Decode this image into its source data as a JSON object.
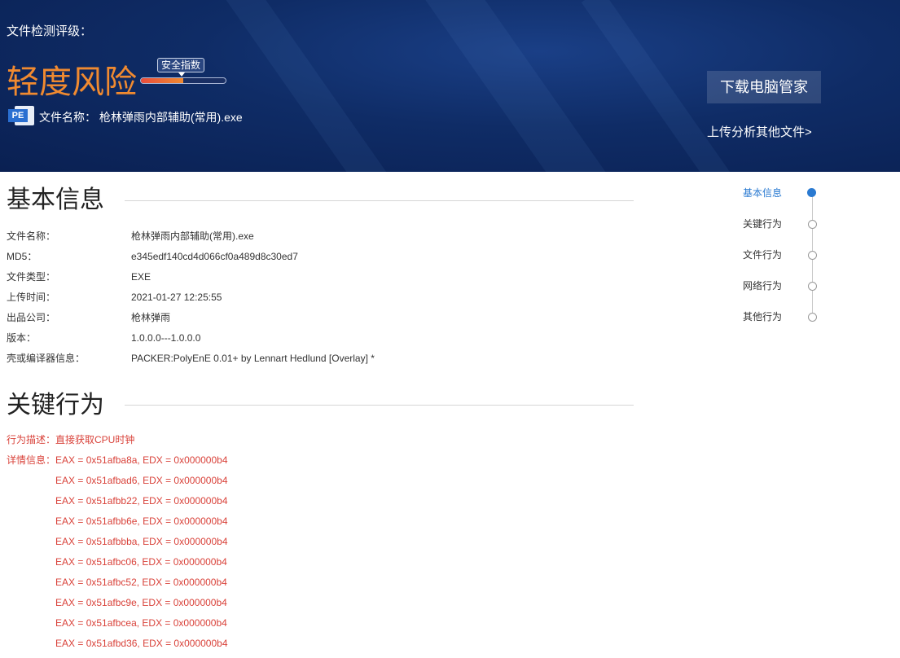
{
  "banner": {
    "rating_label": "文件检测评级：",
    "risk_level": "轻度风险",
    "safety_tag": "安全指数",
    "safety_index_fraction": 0.5,
    "pe_badge": "PE",
    "file_name_label": "文件名称：",
    "file_name": "枪林弹雨内部辅助(常用).exe",
    "download_button": "下载电脑管家",
    "upload_link": "上传分析其他文件>"
  },
  "basic_info": {
    "title": "基本信息",
    "rows": [
      {
        "label": "文件名称：",
        "value": "枪林弹雨内部辅助(常用).exe"
      },
      {
        "label": "MD5：",
        "value": "e345edf140cd4d066cf0a489d8c30ed7"
      },
      {
        "label": "文件类型：",
        "value": "EXE"
      },
      {
        "label": "上传时间：",
        "value": "2021-01-27 12:25:55"
      },
      {
        "label": "出品公司：",
        "value": "枪林弹雨"
      },
      {
        "label": "版本：",
        "value": "1.0.0.0---1.0.0.0"
      },
      {
        "label": "壳或编译器信息：",
        "value": "PACKER:PolyEnE 0.01+ by Lennart Hedlund [Overlay] *"
      }
    ]
  },
  "key_behavior": {
    "title": "关键行为",
    "desc_label": "行为描述：",
    "desc_value": "直接获取CPU时钟",
    "detail_label": "详情信息：",
    "details": [
      "EAX = 0x51afba8a, EDX = 0x000000b4",
      "EAX = 0x51afbad6, EDX = 0x000000b4",
      "EAX = 0x51afbb22, EDX = 0x000000b4",
      "EAX = 0x51afbb6e, EDX = 0x000000b4",
      "EAX = 0x51afbbba, EDX = 0x000000b4",
      "EAX = 0x51afbc06, EDX = 0x000000b4",
      "EAX = 0x51afbc52, EDX = 0x000000b4",
      "EAX = 0x51afbc9e, EDX = 0x000000b4",
      "EAX = 0x51afbcea, EDX = 0x000000b4",
      "EAX = 0x51afbd36, EDX = 0x000000b4"
    ]
  },
  "side_nav": {
    "items": [
      "基本信息",
      "关键行为",
      "文件行为",
      "网络行为",
      "其他行为"
    ],
    "active": 0
  },
  "colors": {
    "risk": "#f08a30",
    "alert_red": "#d9423a",
    "nav_active": "#2a7ad1"
  }
}
